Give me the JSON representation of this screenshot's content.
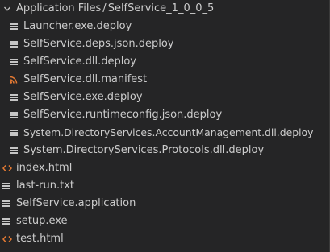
{
  "explorer": {
    "folder": {
      "parent": "Application Files",
      "separator": "/",
      "name": "SelfService_1_0_0_5"
    },
    "folder_items": [
      {
        "label": "Launcher.exe.deploy",
        "icon": "file-lines-icon"
      },
      {
        "label": "SelfService.deps.json.deploy",
        "icon": "file-lines-icon"
      },
      {
        "label": "SelfService.dll.deploy",
        "icon": "file-lines-icon"
      },
      {
        "label": "SelfService.dll.manifest",
        "icon": "rss-icon"
      },
      {
        "label": "SelfService.exe.deploy",
        "icon": "file-lines-icon"
      },
      {
        "label": "SelfService.runtimeconfig.json.deploy",
        "icon": "file-lines-icon"
      },
      {
        "label": "System.DirectoryServices.AccountManagement.dll.deploy",
        "icon": "file-lines-icon"
      },
      {
        "label": "System.DirectoryServices.Protocols.dll.deploy",
        "icon": "file-lines-icon"
      }
    ],
    "root_items": [
      {
        "label": "index.html",
        "icon": "html-code-icon"
      },
      {
        "label": "last-run.txt",
        "icon": "file-lines-icon"
      },
      {
        "label": "SelfService.application",
        "icon": "file-lines-icon"
      },
      {
        "label": "setup.exe",
        "icon": "file-lines-icon"
      },
      {
        "label": "test.html",
        "icon": "html-code-icon"
      }
    ],
    "colors": {
      "background": "#252526",
      "text": "#cccccc",
      "rss_icon": "#e37933",
      "html_icon": "#e37933",
      "file_icon": "#c5c5c5"
    }
  }
}
